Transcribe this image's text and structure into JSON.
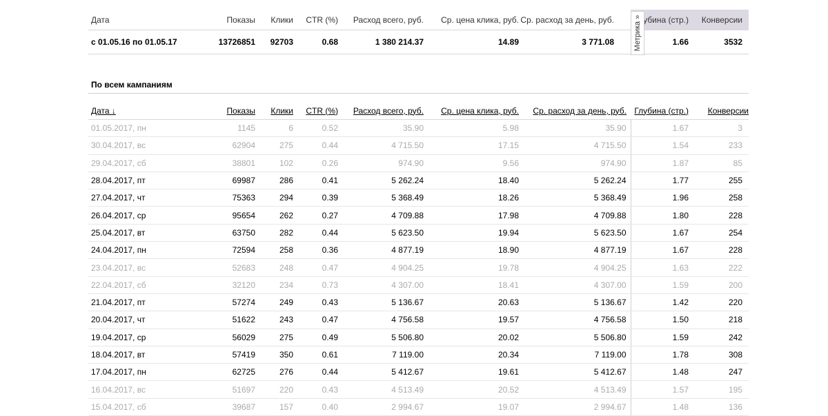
{
  "summary": {
    "headers": [
      "Дата",
      "Показы",
      "Клики",
      "CTR (%)",
      "Расход всего, руб.",
      "Ср. цена клика, руб.",
      "Ср. расход за день, руб.",
      "Глубина (стр.)",
      "Конверсии"
    ],
    "row": [
      "с 01.05.16 по 01.05.17",
      "13726851",
      "92703",
      "0.68",
      "1 380 214.37",
      "14.89",
      "3 771.08",
      "1.66",
      "3532"
    ]
  },
  "metrika_tab": "Метрика »",
  "section_title": "По всем кампаниям",
  "main": {
    "headers": [
      "Дата ↓",
      "Показы",
      "Клики",
      "CTR (%)",
      "Расход всего, руб.",
      "Ср. цена клика, руб.",
      "Ср. расход за день, руб.",
      "Глубина (стр.)",
      "Конверсии"
    ],
    "rows": [
      {
        "weekend": true,
        "cells": [
          "01.05.2017, пн",
          "1145",
          "6",
          "0.52",
          "35.90",
          "5.98",
          "35.90",
          "1.67",
          "3"
        ]
      },
      {
        "weekend": true,
        "cells": [
          "30.04.2017, вс",
          "62904",
          "275",
          "0.44",
          "4 715.50",
          "17.15",
          "4 715.50",
          "1.54",
          "233"
        ]
      },
      {
        "weekend": true,
        "cells": [
          "29.04.2017, сб",
          "38801",
          "102",
          "0.26",
          "974.90",
          "9.56",
          "974.90",
          "1.87",
          "85"
        ]
      },
      {
        "weekend": false,
        "cells": [
          "28.04.2017, пт",
          "69987",
          "286",
          "0.41",
          "5 262.24",
          "18.40",
          "5 262.24",
          "1.77",
          "255"
        ]
      },
      {
        "weekend": false,
        "cells": [
          "27.04.2017, чт",
          "75363",
          "294",
          "0.39",
          "5 368.49",
          "18.26",
          "5 368.49",
          "1.96",
          "258"
        ]
      },
      {
        "weekend": false,
        "cells": [
          "26.04.2017, ср",
          "95654",
          "262",
          "0.27",
          "4 709.88",
          "17.98",
          "4 709.88",
          "1.80",
          "228"
        ]
      },
      {
        "weekend": false,
        "cells": [
          "25.04.2017, вт",
          "63750",
          "282",
          "0.44",
          "5 623.50",
          "19.94",
          "5 623.50",
          "1.67",
          "254"
        ]
      },
      {
        "weekend": false,
        "cells": [
          "24.04.2017, пн",
          "72594",
          "258",
          "0.36",
          "4 877.19",
          "18.90",
          "4 877.19",
          "1.67",
          "228"
        ]
      },
      {
        "weekend": true,
        "cells": [
          "23.04.2017, вс",
          "52683",
          "248",
          "0.47",
          "4 904.25",
          "19.78",
          "4 904.25",
          "1.63",
          "222"
        ]
      },
      {
        "weekend": true,
        "cells": [
          "22.04.2017, сб",
          "32120",
          "234",
          "0.73",
          "4 307.00",
          "18.41",
          "4 307.00",
          "1.59",
          "200"
        ]
      },
      {
        "weekend": false,
        "cells": [
          "21.04.2017, пт",
          "57274",
          "249",
          "0.43",
          "5 136.67",
          "20.63",
          "5 136.67",
          "1.42",
          "220"
        ]
      },
      {
        "weekend": false,
        "cells": [
          "20.04.2017, чт",
          "51622",
          "243",
          "0.47",
          "4 756.58",
          "19.57",
          "4 756.58",
          "1.50",
          "218"
        ]
      },
      {
        "weekend": false,
        "cells": [
          "19.04.2017, ср",
          "56029",
          "275",
          "0.49",
          "5 506.80",
          "20.02",
          "5 506.80",
          "1.59",
          "242"
        ]
      },
      {
        "weekend": false,
        "cells": [
          "18.04.2017, вт",
          "57419",
          "350",
          "0.61",
          "7 119.00",
          "20.34",
          "7 119.00",
          "1.78",
          "308"
        ]
      },
      {
        "weekend": false,
        "cells": [
          "17.04.2017, пн",
          "62725",
          "276",
          "0.44",
          "5 412.67",
          "19.61",
          "5 412.67",
          "1.48",
          "247"
        ]
      },
      {
        "weekend": true,
        "cells": [
          "16.04.2017, вс",
          "51697",
          "220",
          "0.43",
          "4 513.49",
          "20.52",
          "4 513.49",
          "1.57",
          "195"
        ]
      },
      {
        "weekend": true,
        "cells": [
          "15.04.2017, сб",
          "39687",
          "157",
          "0.40",
          "2 994.67",
          "19.07",
          "2 994.67",
          "1.48",
          "136"
        ]
      }
    ]
  }
}
